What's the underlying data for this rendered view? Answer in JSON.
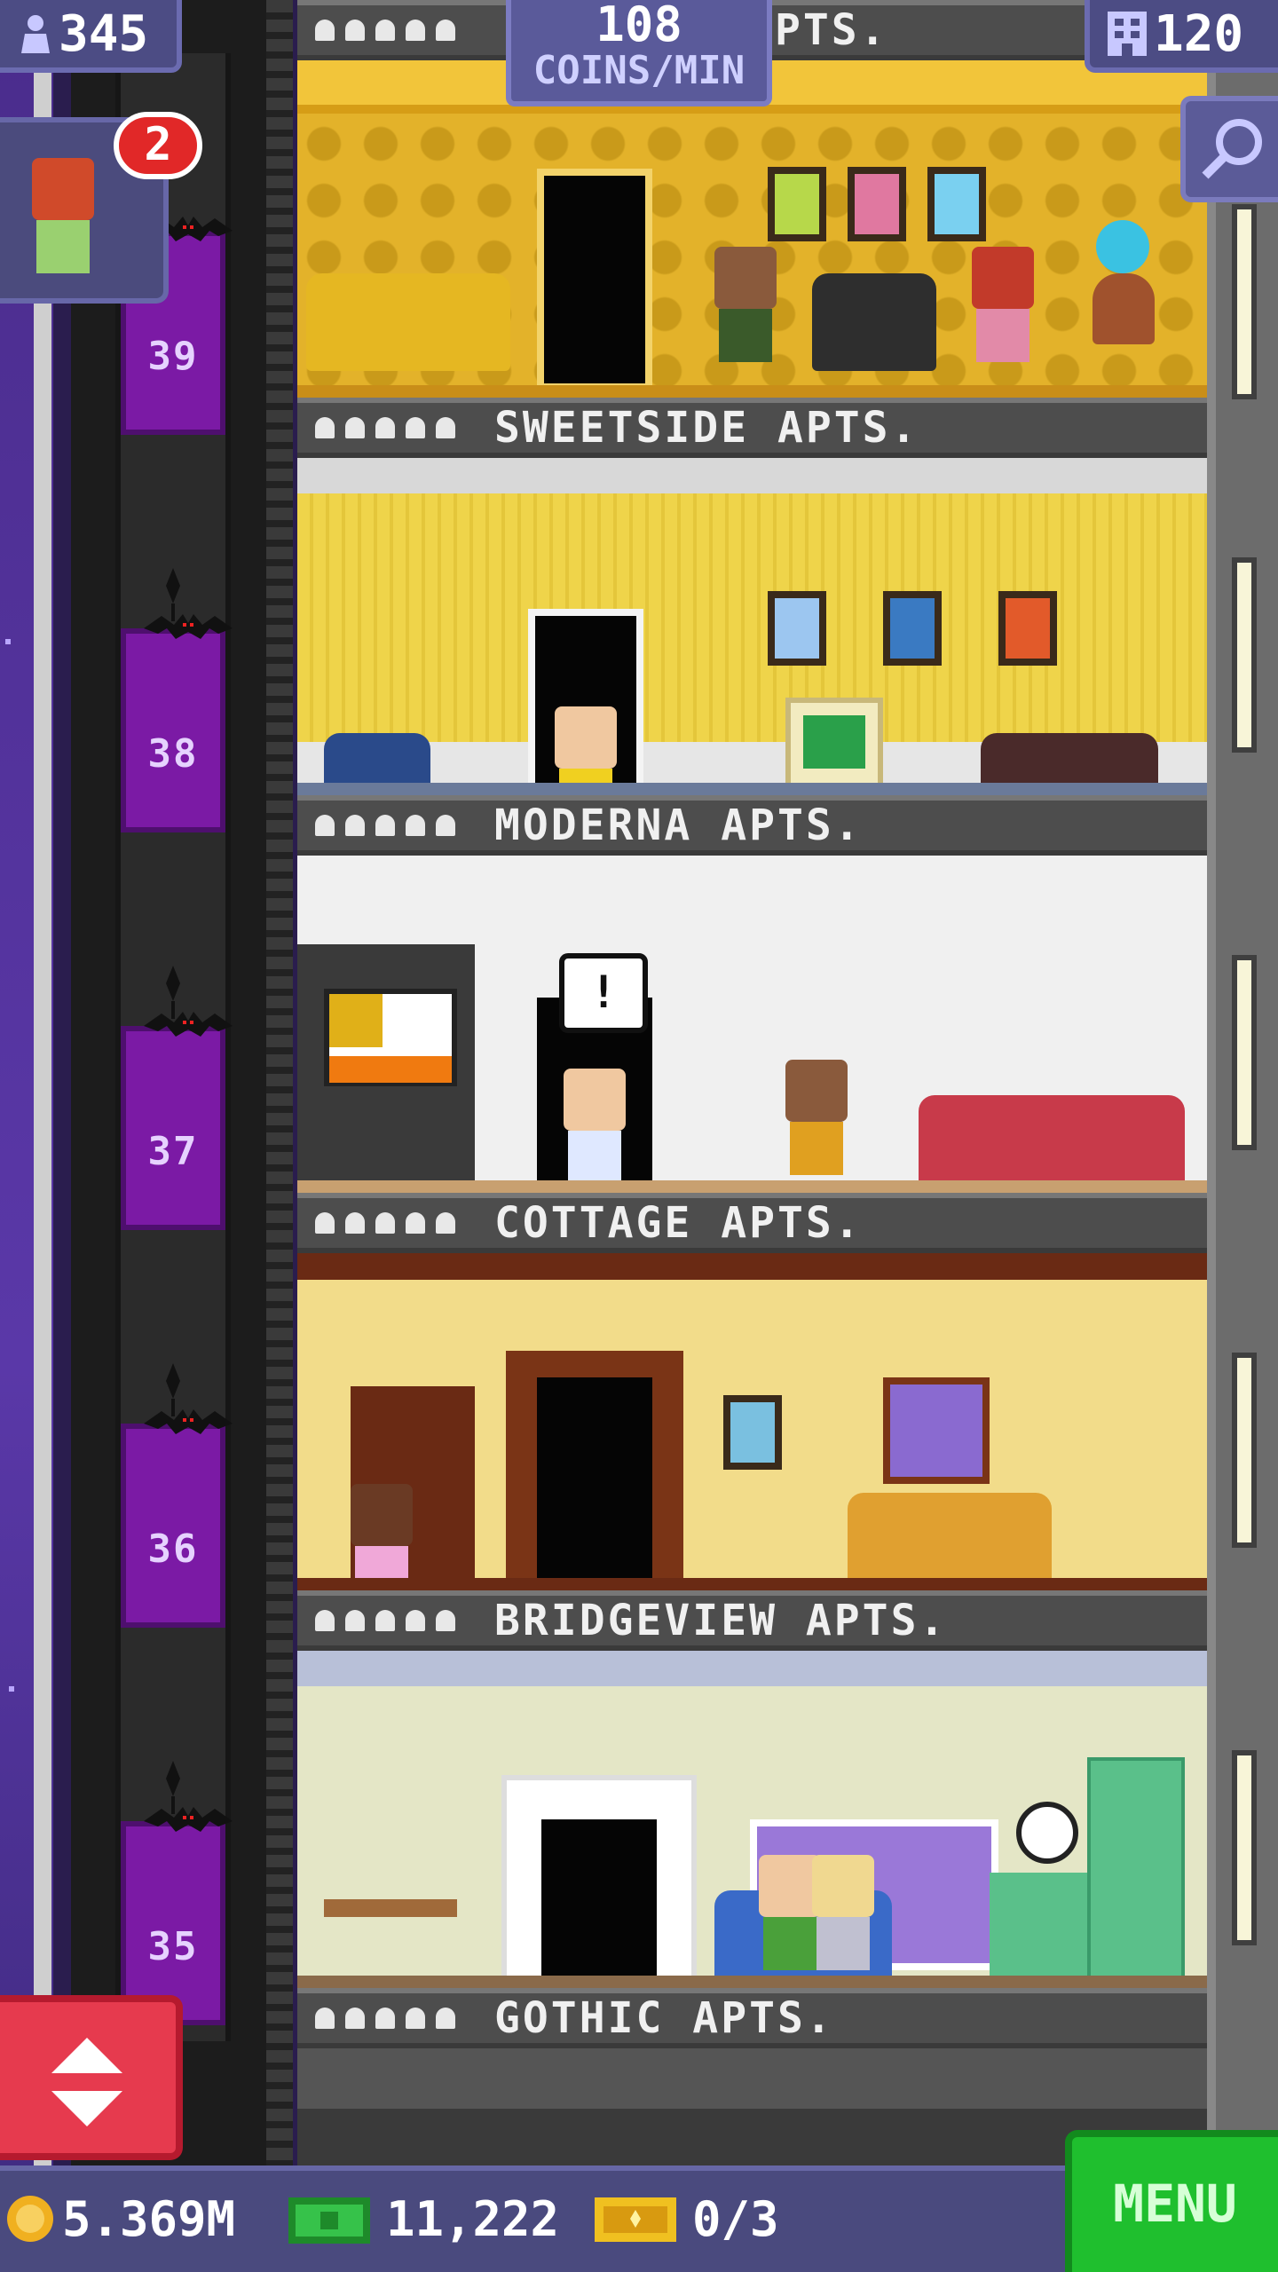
{
  "hud": {
    "population": "345",
    "coins_per_min_value": "108",
    "coins_per_min_label": "COINS/MIN",
    "floors": "120",
    "notification_count": "2"
  },
  "floors": [
    {
      "name": "SWEETSIDE APTS.",
      "elevator_number": "39",
      "color": "#e8b828"
    },
    {
      "name": "MODERNA APTS.",
      "elevator_number": "38",
      "color": "#efd44a"
    },
    {
      "name": "COTTAGE APTS.",
      "elevator_number": "37",
      "color": "#f0f0f0"
    },
    {
      "name": "BRIDGEVIEW APTS.",
      "elevator_number": "36",
      "color": "#f2dc8a"
    },
    {
      "name": "GOTHIC APTS.",
      "elevator_number": "35",
      "color": "#e4e6c6"
    }
  ],
  "top_sign_partial": "PTS.",
  "speech_bubble": "!",
  "bottom": {
    "coins": "5.369M",
    "bux": "11,222",
    "tickets": "0/3",
    "menu_label": "MENU"
  },
  "colors": {
    "elevator_door": "#7b1aa5",
    "menu_green": "#1fbf2e",
    "elevator_button_red": "#e63a4e",
    "hud_purple": "#4c4c84"
  }
}
